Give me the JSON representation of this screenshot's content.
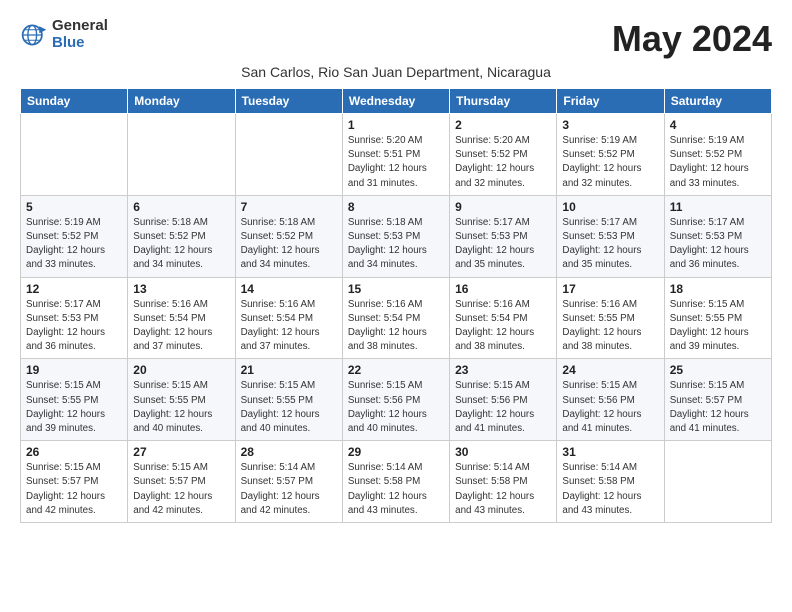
{
  "header": {
    "logo_general": "General",
    "logo_blue": "Blue",
    "month_title": "May 2024",
    "subtitle": "San Carlos, Rio San Juan Department, Nicaragua"
  },
  "weekdays": [
    "Sunday",
    "Monday",
    "Tuesday",
    "Wednesday",
    "Thursday",
    "Friday",
    "Saturday"
  ],
  "weeks": [
    [
      {
        "day": "",
        "info": ""
      },
      {
        "day": "",
        "info": ""
      },
      {
        "day": "",
        "info": ""
      },
      {
        "day": "1",
        "info": "Sunrise: 5:20 AM\nSunset: 5:51 PM\nDaylight: 12 hours\nand 31 minutes."
      },
      {
        "day": "2",
        "info": "Sunrise: 5:20 AM\nSunset: 5:52 PM\nDaylight: 12 hours\nand 32 minutes."
      },
      {
        "day": "3",
        "info": "Sunrise: 5:19 AM\nSunset: 5:52 PM\nDaylight: 12 hours\nand 32 minutes."
      },
      {
        "day": "4",
        "info": "Sunrise: 5:19 AM\nSunset: 5:52 PM\nDaylight: 12 hours\nand 33 minutes."
      }
    ],
    [
      {
        "day": "5",
        "info": "Sunrise: 5:19 AM\nSunset: 5:52 PM\nDaylight: 12 hours\nand 33 minutes."
      },
      {
        "day": "6",
        "info": "Sunrise: 5:18 AM\nSunset: 5:52 PM\nDaylight: 12 hours\nand 34 minutes."
      },
      {
        "day": "7",
        "info": "Sunrise: 5:18 AM\nSunset: 5:52 PM\nDaylight: 12 hours\nand 34 minutes."
      },
      {
        "day": "8",
        "info": "Sunrise: 5:18 AM\nSunset: 5:53 PM\nDaylight: 12 hours\nand 34 minutes."
      },
      {
        "day": "9",
        "info": "Sunrise: 5:17 AM\nSunset: 5:53 PM\nDaylight: 12 hours\nand 35 minutes."
      },
      {
        "day": "10",
        "info": "Sunrise: 5:17 AM\nSunset: 5:53 PM\nDaylight: 12 hours\nand 35 minutes."
      },
      {
        "day": "11",
        "info": "Sunrise: 5:17 AM\nSunset: 5:53 PM\nDaylight: 12 hours\nand 36 minutes."
      }
    ],
    [
      {
        "day": "12",
        "info": "Sunrise: 5:17 AM\nSunset: 5:53 PM\nDaylight: 12 hours\nand 36 minutes."
      },
      {
        "day": "13",
        "info": "Sunrise: 5:16 AM\nSunset: 5:54 PM\nDaylight: 12 hours\nand 37 minutes."
      },
      {
        "day": "14",
        "info": "Sunrise: 5:16 AM\nSunset: 5:54 PM\nDaylight: 12 hours\nand 37 minutes."
      },
      {
        "day": "15",
        "info": "Sunrise: 5:16 AM\nSunset: 5:54 PM\nDaylight: 12 hours\nand 38 minutes."
      },
      {
        "day": "16",
        "info": "Sunrise: 5:16 AM\nSunset: 5:54 PM\nDaylight: 12 hours\nand 38 minutes."
      },
      {
        "day": "17",
        "info": "Sunrise: 5:16 AM\nSunset: 5:55 PM\nDaylight: 12 hours\nand 38 minutes."
      },
      {
        "day": "18",
        "info": "Sunrise: 5:15 AM\nSunset: 5:55 PM\nDaylight: 12 hours\nand 39 minutes."
      }
    ],
    [
      {
        "day": "19",
        "info": "Sunrise: 5:15 AM\nSunset: 5:55 PM\nDaylight: 12 hours\nand 39 minutes."
      },
      {
        "day": "20",
        "info": "Sunrise: 5:15 AM\nSunset: 5:55 PM\nDaylight: 12 hours\nand 40 minutes."
      },
      {
        "day": "21",
        "info": "Sunrise: 5:15 AM\nSunset: 5:55 PM\nDaylight: 12 hours\nand 40 minutes."
      },
      {
        "day": "22",
        "info": "Sunrise: 5:15 AM\nSunset: 5:56 PM\nDaylight: 12 hours\nand 40 minutes."
      },
      {
        "day": "23",
        "info": "Sunrise: 5:15 AM\nSunset: 5:56 PM\nDaylight: 12 hours\nand 41 minutes."
      },
      {
        "day": "24",
        "info": "Sunrise: 5:15 AM\nSunset: 5:56 PM\nDaylight: 12 hours\nand 41 minutes."
      },
      {
        "day": "25",
        "info": "Sunrise: 5:15 AM\nSunset: 5:57 PM\nDaylight: 12 hours\nand 41 minutes."
      }
    ],
    [
      {
        "day": "26",
        "info": "Sunrise: 5:15 AM\nSunset: 5:57 PM\nDaylight: 12 hours\nand 42 minutes."
      },
      {
        "day": "27",
        "info": "Sunrise: 5:15 AM\nSunset: 5:57 PM\nDaylight: 12 hours\nand 42 minutes."
      },
      {
        "day": "28",
        "info": "Sunrise: 5:14 AM\nSunset: 5:57 PM\nDaylight: 12 hours\nand 42 minutes."
      },
      {
        "day": "29",
        "info": "Sunrise: 5:14 AM\nSunset: 5:58 PM\nDaylight: 12 hours\nand 43 minutes."
      },
      {
        "day": "30",
        "info": "Sunrise: 5:14 AM\nSunset: 5:58 PM\nDaylight: 12 hours\nand 43 minutes."
      },
      {
        "day": "31",
        "info": "Sunrise: 5:14 AM\nSunset: 5:58 PM\nDaylight: 12 hours\nand 43 minutes."
      },
      {
        "day": "",
        "info": ""
      }
    ]
  ]
}
